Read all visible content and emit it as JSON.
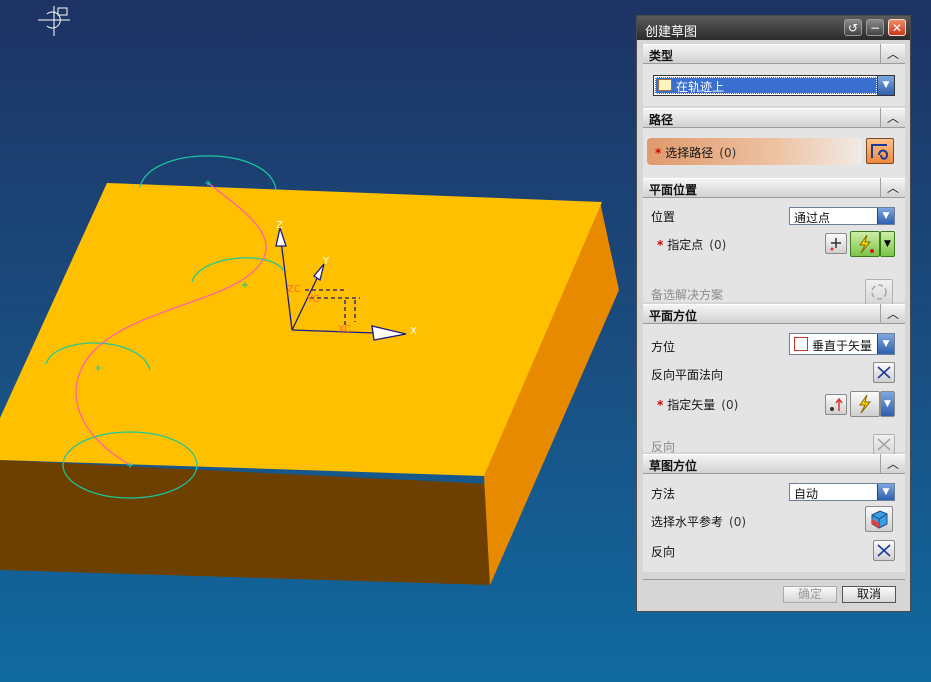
{
  "dialog": {
    "title": "创建草图",
    "controls": {
      "reset": "↺",
      "minimize": "−",
      "close": "✕"
    },
    "sections": {
      "type": {
        "label": "类型",
        "value": "在轨迹上"
      },
      "path": {
        "label": "路径",
        "select_path": "选择路径",
        "select_path_count": "(0)"
      },
      "plane_position": {
        "label": "平面位置",
        "position_label": "位置",
        "position_value": "通过点",
        "specify_point": "指定点",
        "specify_point_count": "(0)",
        "alternate_solution": "备选解决方案"
      },
      "plane_orientation": {
        "label": "平面方位",
        "direction_label": "方位",
        "direction_value": "垂直于矢量",
        "reverse_normal": "反向平面法向",
        "specify_vector": "指定矢量",
        "specify_vector_count": "(0)",
        "reverse": "反向"
      },
      "sketch_orientation": {
        "label": "草图方位",
        "method_label": "方法",
        "method_value": "自动",
        "select_horizontal_ref": "选择水平参考",
        "select_horizontal_ref_count": "(0)",
        "reverse": "反向"
      }
    },
    "ok_label": "确定",
    "cancel_label": "取消"
  },
  "viewport": {
    "axes": {
      "x": "X",
      "y": "Y",
      "z": "Z",
      "xc": "XC",
      "yc": "YC",
      "zc": "ZC"
    },
    "colors": {
      "block_top": "#ffc000",
      "block_side": "#e88a00",
      "block_front": "#6e4000",
      "curve": "#ff5ab4",
      "circles": "#19c8a0"
    }
  }
}
